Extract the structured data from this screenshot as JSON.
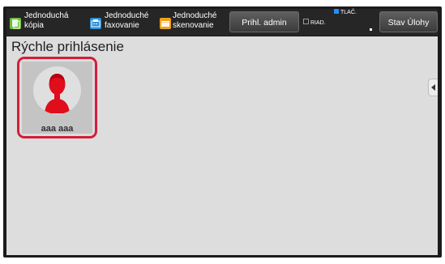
{
  "header": {
    "shortcuts": [
      {
        "line1": "Jednoduchá",
        "line2": "kópia",
        "icon": "copy-icon",
        "color": "#6cbf3b"
      },
      {
        "line1": "Jednoduché",
        "line2": "faxovanie",
        "icon": "fax-icon",
        "color": "#2e8fd6"
      },
      {
        "line1": "Jednoduché",
        "line2": "skenovanie",
        "icon": "scan-icon",
        "color": "#f0a11d"
      }
    ],
    "admin_login": "Prihl. admin",
    "status_riad": "RIAD.",
    "status_tlac": "TLAČ.",
    "job_status": "Stav Úlohy"
  },
  "main": {
    "title": "Rýchle prihlásenie",
    "users": [
      {
        "name": "aaa aaa"
      }
    ]
  },
  "colors": {
    "selection_border": "#d21f39",
    "avatar_icon": "#e00d1d",
    "status_tlac": "#1e90ff"
  }
}
